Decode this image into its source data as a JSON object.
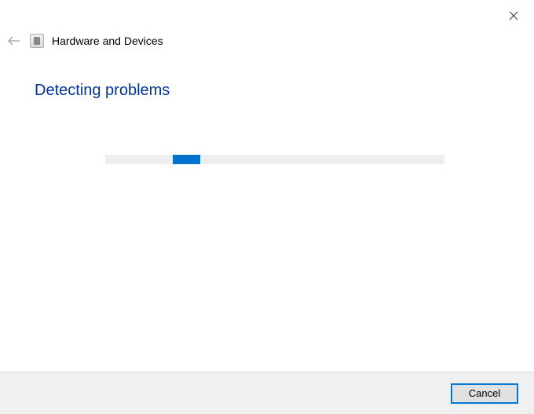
{
  "header": {
    "window_title": "Hardware and Devices"
  },
  "main": {
    "heading": "Detecting problems"
  },
  "footer": {
    "cancel_label": "Cancel"
  },
  "colors": {
    "accent": "#0078d7",
    "heading": "#003399",
    "progress_fill": "#0073cf",
    "progress_track": "#eeeeee",
    "footer_bg": "#f0f0f0"
  }
}
